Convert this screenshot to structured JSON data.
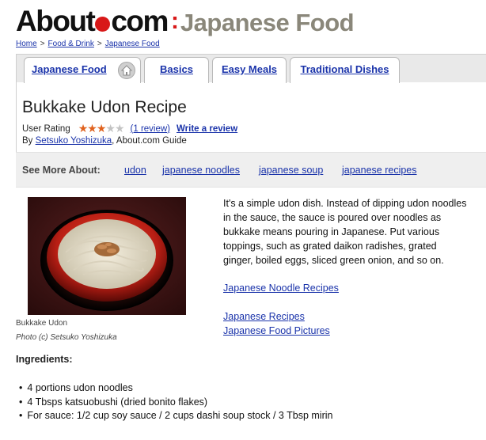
{
  "logo": {
    "about": "About",
    "com": "com",
    "colon": ":",
    "section": "Japanese Food"
  },
  "breadcrumb": [
    "Home",
    "Food & Drink",
    "Japanese Food"
  ],
  "breadcrumb_sep": ">",
  "tabs": [
    {
      "label": "Japanese Food",
      "icon": "home-icon"
    },
    {
      "label": "Basics"
    },
    {
      "label": "Easy Meals"
    },
    {
      "label": "Traditional Dishes"
    }
  ],
  "recipe": {
    "title": "Bukkake Udon Recipe",
    "rating_label": "User Rating",
    "rating": 3,
    "rating_max": 5,
    "review_count": "(1 review)",
    "write_review": "Write a review",
    "byline_prefix": "By",
    "author": "Setsuko Yoshizuka",
    "byline_suffix": ", About.com Guide"
  },
  "see_more": {
    "label": "See More About:",
    "links": [
      "udon",
      "japanese noodles",
      "japanese soup",
      "japanese recipes"
    ]
  },
  "photo": {
    "caption": "Bukkake Udon",
    "credit": "Photo (c) Setsuko Yoshizuka"
  },
  "intro": "It's a simple udon dish. Instead of dipping udon noodles in the sauce, the sauce is poured over noodles as bukkake means pouring in Japanese. Put various toppings, such as grated daikon radishes, grated ginger, boiled eggs, sliced green onion, and so on.",
  "related_links": [
    "Japanese Noodle Recipes",
    "Japanese Recipes",
    "Japanese Food Pictures"
  ],
  "ingredients": {
    "heading": "Ingredients:",
    "items": [
      "4 portions udon noodles",
      "4 Tbsps katsuobushi (dried bonito flakes)",
      "For sauce: 1/2 cup soy sauce / 2 cups dashi soup stock / 3 Tbsp mirin"
    ]
  },
  "colors": {
    "link": "#1a33aa",
    "logo_red": "#d81818",
    "section_gray": "#8a877a",
    "star": "#e0621e"
  }
}
